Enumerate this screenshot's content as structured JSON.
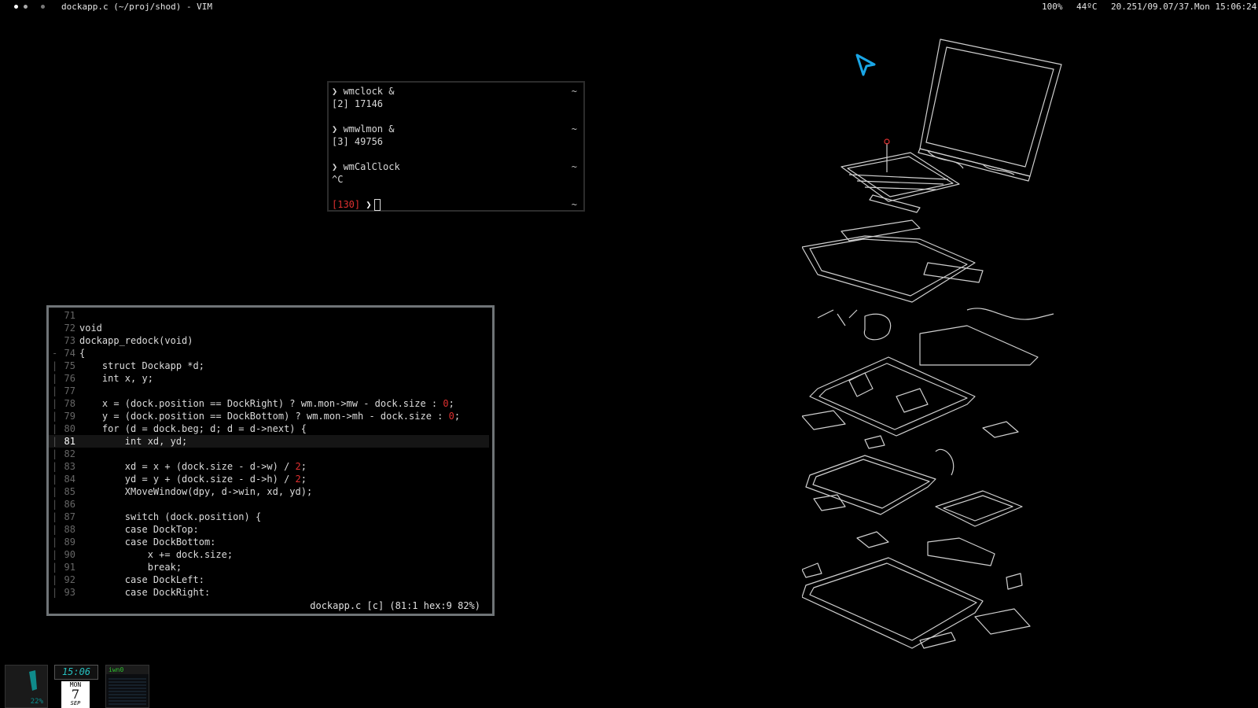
{
  "topbar": {
    "window_title": "dockapp.c (~/proj/shod) - VIM",
    "battery": "100%",
    "temperature": "44ºC",
    "datetime": "20.251/09.07/37.Mon 15:06:24"
  },
  "terminal": {
    "lines": [
      {
        "text": "❯ wmclock &",
        "tilde": "~"
      },
      {
        "text": "[2] 17146",
        "tilde": ""
      },
      {
        "text": "",
        "tilde": ""
      },
      {
        "text": "❯ wmwlmon &",
        "tilde": "~"
      },
      {
        "text": "[3] 49756",
        "tilde": ""
      },
      {
        "text": "",
        "tilde": ""
      },
      {
        "text": "❯ wmCalClock",
        "tilde": "~"
      },
      {
        "text": "^C",
        "tilde": ""
      },
      {
        "text": "",
        "tilde": ""
      }
    ],
    "exit_code": "[130]",
    "prompt_symbol": "❯",
    "prompt_tilde": "~"
  },
  "editor": {
    "status_line": "dockapp.c [c] (81:1 hex:9 82%)",
    "lines": [
      {
        "num": "71",
        "fold": "",
        "code": ""
      },
      {
        "num": "72",
        "fold": "",
        "code": "void"
      },
      {
        "num": "73",
        "fold": "",
        "code": "dockapp_redock(void)"
      },
      {
        "num": "74",
        "fold": "-",
        "code": "{"
      },
      {
        "num": "75",
        "fold": "|",
        "code": "    struct Dockapp *d;"
      },
      {
        "num": "76",
        "fold": "|",
        "code": "    int x, y;"
      },
      {
        "num": "77",
        "fold": "|",
        "code": ""
      },
      {
        "num": "78",
        "fold": "|",
        "code": "    x = (dock.position == DockRight) ? wm.mon->mw - dock.size : 0;"
      },
      {
        "num": "79",
        "fold": "|",
        "code": "    y = (dock.position == DockBottom) ? wm.mon->mh - dock.size : 0;"
      },
      {
        "num": "80",
        "fold": "|",
        "code": "    for (d = dock.beg; d; d = d->next) {"
      },
      {
        "num": "81",
        "fold": "|",
        "code": "        int xd, yd;"
      },
      {
        "num": "82",
        "fold": "|",
        "code": ""
      },
      {
        "num": "83",
        "fold": "|",
        "code": "        xd = x + (dock.size - d->w) / 2;"
      },
      {
        "num": "84",
        "fold": "|",
        "code": "        yd = y + (dock.size - d->h) / 2;"
      },
      {
        "num": "85",
        "fold": "|",
        "code": "        XMoveWindow(dpy, d->win, xd, yd);"
      },
      {
        "num": "86",
        "fold": "|",
        "code": ""
      },
      {
        "num": "87",
        "fold": "|",
        "code": "        switch (dock.position) {"
      },
      {
        "num": "88",
        "fold": "|",
        "code": "        case DockTop:"
      },
      {
        "num": "89",
        "fold": "|",
        "code": "        case DockBottom:"
      },
      {
        "num": "90",
        "fold": "|",
        "code": "            x += dock.size;"
      },
      {
        "num": "91",
        "fold": "|",
        "code": "            break;"
      },
      {
        "num": "92",
        "fold": "|",
        "code": "        case DockLeft:"
      },
      {
        "num": "93",
        "fold": "|",
        "code": "        case DockRight:"
      }
    ],
    "current_line": "81"
  },
  "dock": {
    "battery_label": "22%",
    "clock_time": "15:06",
    "calendar_dow": "MON",
    "calendar_day": "7",
    "calendar_month": "SEP",
    "wlmon_iface": "iwn0"
  },
  "colors": {
    "background": "#000000",
    "error_red": "#e03030",
    "cursor_cyan": "#1aa6e6",
    "dock_teal": "#26c0c0"
  }
}
